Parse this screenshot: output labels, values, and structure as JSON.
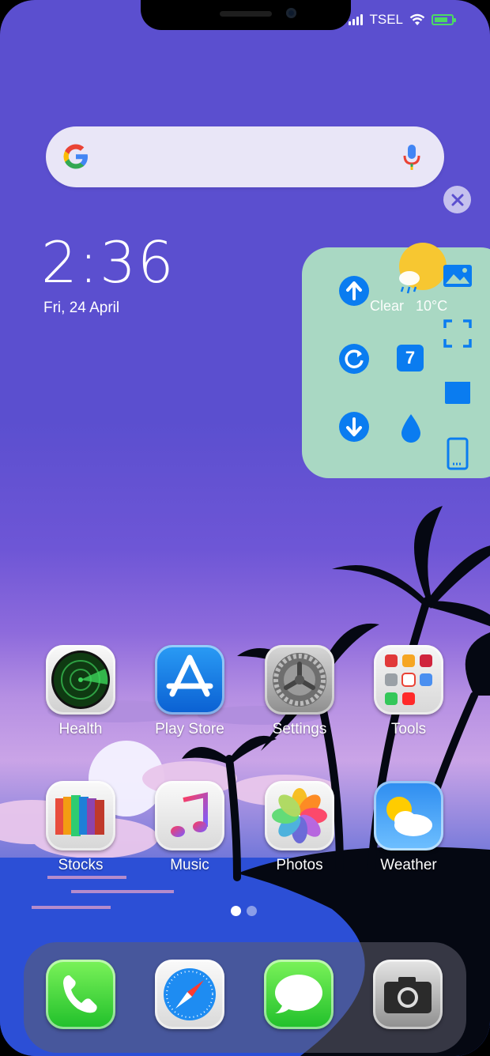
{
  "status": {
    "carrier": "TSEL"
  },
  "search": {
    "engine_icon": "google-g-icon",
    "mic_icon": "microphone-icon"
  },
  "clock": {
    "time": "2:36",
    "date": "Fri, 24 April"
  },
  "widget": {
    "weather": {
      "condition": "Clear",
      "temperature": "10°C"
    },
    "date_badge": "7",
    "icons": [
      "upload-icon",
      "rotate-icon",
      "download-icon",
      "water-drop-icon",
      "image-icon",
      "screenshot-icon",
      "notes-icon",
      "phone-device-icon"
    ]
  },
  "apps_row1": [
    {
      "label": "Health"
    },
    {
      "label": "Play Store"
    },
    {
      "label": "Settings"
    },
    {
      "label": "Tools"
    }
  ],
  "apps_row2": [
    {
      "label": "Stocks"
    },
    {
      "label": "Music"
    },
    {
      "label": "Photos"
    },
    {
      "label": "Weather"
    }
  ],
  "dock": [
    "phone-app",
    "safari-app",
    "messages-app",
    "camera-app"
  ],
  "page_indicator": {
    "pages": 2,
    "current": 1
  },
  "colors": {
    "wallpaper": "#5b4fcf",
    "panel": "#a9d8c3",
    "accent_blue": "#0a7cf0"
  }
}
